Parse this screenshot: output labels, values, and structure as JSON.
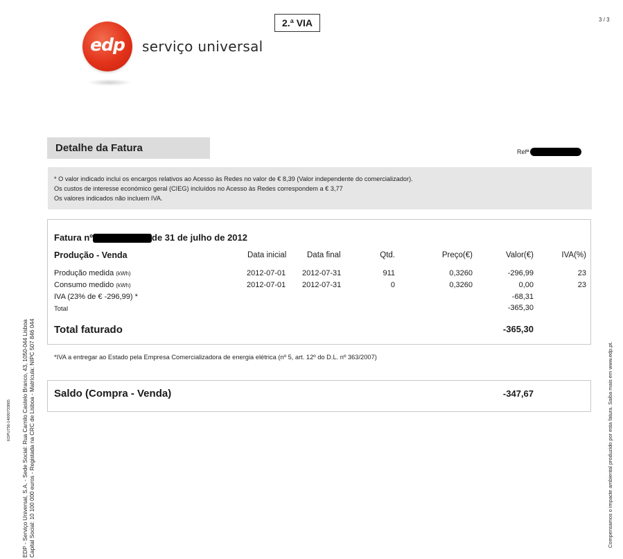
{
  "header": {
    "logo_text": "edp",
    "brand_name": "serviço universal",
    "copy_label": "2.ª VIA",
    "page_number": "3 / 3"
  },
  "section": {
    "title": "Detalhe da Fatura",
    "ref_label": "Refª"
  },
  "info": {
    "lines": [
      "* O valor indicado inclui os encargos relativos ao Acesso às Redes no valor de € 8,39 (Valor independente do comercializador).",
      "Os custos de interesse económico geral (CIEG) incluídos no Acesso às Redes correspondem a € 3,77",
      "Os valores indicados não incluem IVA."
    ]
  },
  "invoice": {
    "title_prefix": "Fatura nº",
    "title_suffix": "de 31 de julho de 2012",
    "columns": {
      "description": "Produção - Venda",
      "start": "Data inicial",
      "end": "Data final",
      "qty": "Qtd.",
      "price": "Preço(€)",
      "value": "Valor(€)",
      "vat": "IVA(%)"
    },
    "rows": [
      {
        "desc": "Produção medida",
        "unit": "(kWh)",
        "start": "2012-07-01",
        "end": "2012-07-31",
        "qty": "911",
        "price": "0,3260",
        "value": "-296,99",
        "vat": "23"
      },
      {
        "desc": "Consumo medido",
        "unit": "(kWh)",
        "start": "2012-07-01",
        "end": "2012-07-31",
        "qty": "0",
        "price": "0,3260",
        "value": "0,00",
        "vat": "23"
      },
      {
        "desc": "IVA (23% de  € -296,99) *",
        "unit": "",
        "start": "",
        "end": "",
        "qty": "",
        "price": "",
        "value": "-68,31",
        "vat": ""
      },
      {
        "desc": "Total",
        "unit": "",
        "start": "",
        "end": "",
        "qty": "",
        "price": "",
        "value": "-365,30",
        "vat": ""
      }
    ],
    "total_label": "Total faturado",
    "total_value": "-365,30"
  },
  "footnote": "*IVA a entregar ao Estado pela Empresa Comercializadora de energia elétrica (nº 5, art. 12º do D.L. nº 363/2007)",
  "saldo": {
    "label": "Saldo (Compra - Venda)",
    "value": "-347,67"
  },
  "side": {
    "doc_code": "EDPU756-14000733865",
    "company_line_1": "EDP - Serviço Universal, S.A. - Sede Social: Rua Camilo Castelo Branco, 43, 1050-044 Lisboa",
    "company_line_2": "Capital Social: 10 100 000 euros - Registada na CRC de Lisboa - Matrícula: NIPC 507 846 044",
    "right_note": "Compensamos o impacte ambiental produzido por esta fatura. Saiba mais em www.edp.pt."
  },
  "colors": {
    "brand_red": "#e2331a",
    "panel_gray": "#dcdcdc",
    "info_gray": "#e6e6e6"
  }
}
